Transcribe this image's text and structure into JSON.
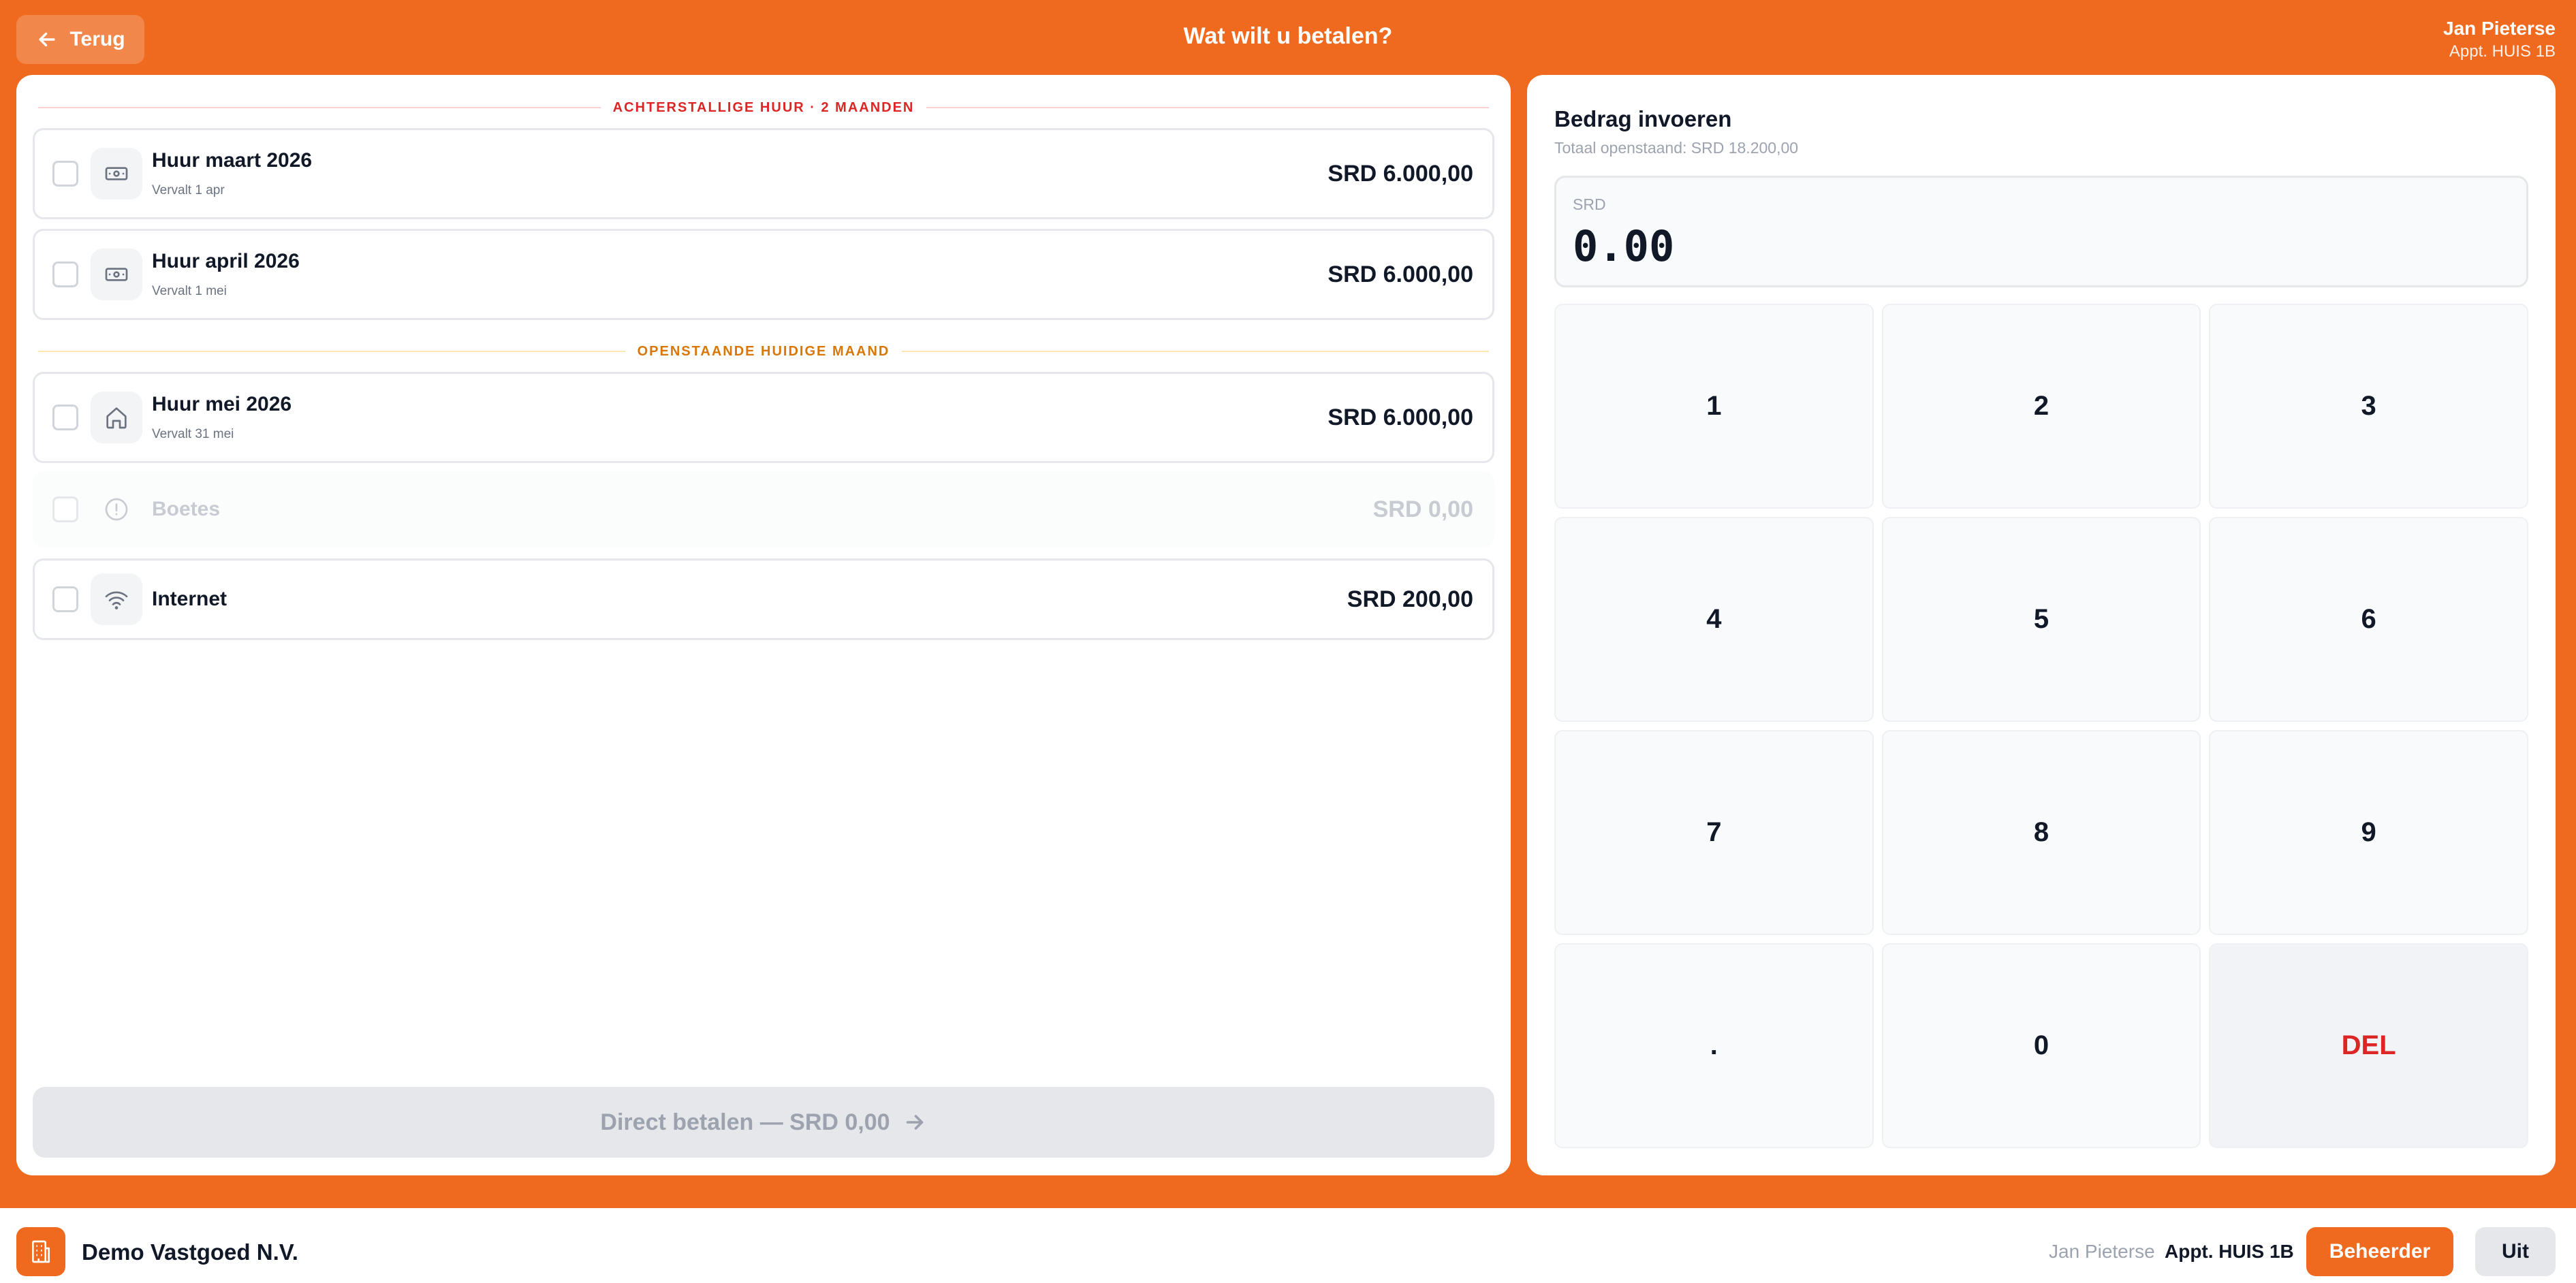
{
  "header": {
    "back_label": "Terug",
    "title": "Wat wilt u betalen?",
    "user_name": "Jan Pieterse",
    "user_unit": "Appt. HUIS 1B"
  },
  "sections": {
    "arrears": "ACHTERSTALLIGE HUUR · 2 MAANDEN",
    "current": "OPENSTAANDE HUIDIGE MAAND"
  },
  "items": [
    {
      "title": "Huur maart 2026",
      "sub": "Vervalt 1 apr",
      "amount": "SRD 6.000,00",
      "icon": "money-icon",
      "checked": false
    },
    {
      "title": "Huur april 2026",
      "sub": "Vervalt 1 mei",
      "amount": "SRD 6.000,00",
      "icon": "money-icon",
      "checked": false
    },
    {
      "title": "Huur mei 2026",
      "sub": "Vervalt 31 mei",
      "amount": "SRD 6.000,00",
      "icon": "home-icon",
      "checked": false
    },
    {
      "title": "Boetes",
      "sub": "",
      "amount": "SRD 0,00",
      "icon": "alert-circle-icon",
      "checked": false,
      "disabled": true
    },
    {
      "title": "Internet",
      "sub": "",
      "amount": "SRD 200,00",
      "icon": "wifi-icon",
      "checked": false
    }
  ],
  "pay_button": {
    "label": "Direct betalen — SRD 0,00"
  },
  "amount_entry": {
    "title": "Bedrag invoeren",
    "total_outstanding": "Totaal openstaand: SRD 18.200,00",
    "currency": "SRD",
    "value": "0.00"
  },
  "keypad": [
    "1",
    "2",
    "3",
    "4",
    "5",
    "6",
    "7",
    "8",
    "9",
    ".",
    "0",
    "DEL"
  ],
  "footer": {
    "company": "Demo Vastgoed N.V.",
    "user_name": "Jan Pieterse",
    "unit": "Appt. HUIS 1B",
    "admin_label": "Beheerder",
    "exit_label": "Uit"
  },
  "colors": {
    "brand": "#ef6a1e",
    "arrears_label": "#dc2626",
    "current_label": "#d97706",
    "delete_key": "#dc2626"
  }
}
